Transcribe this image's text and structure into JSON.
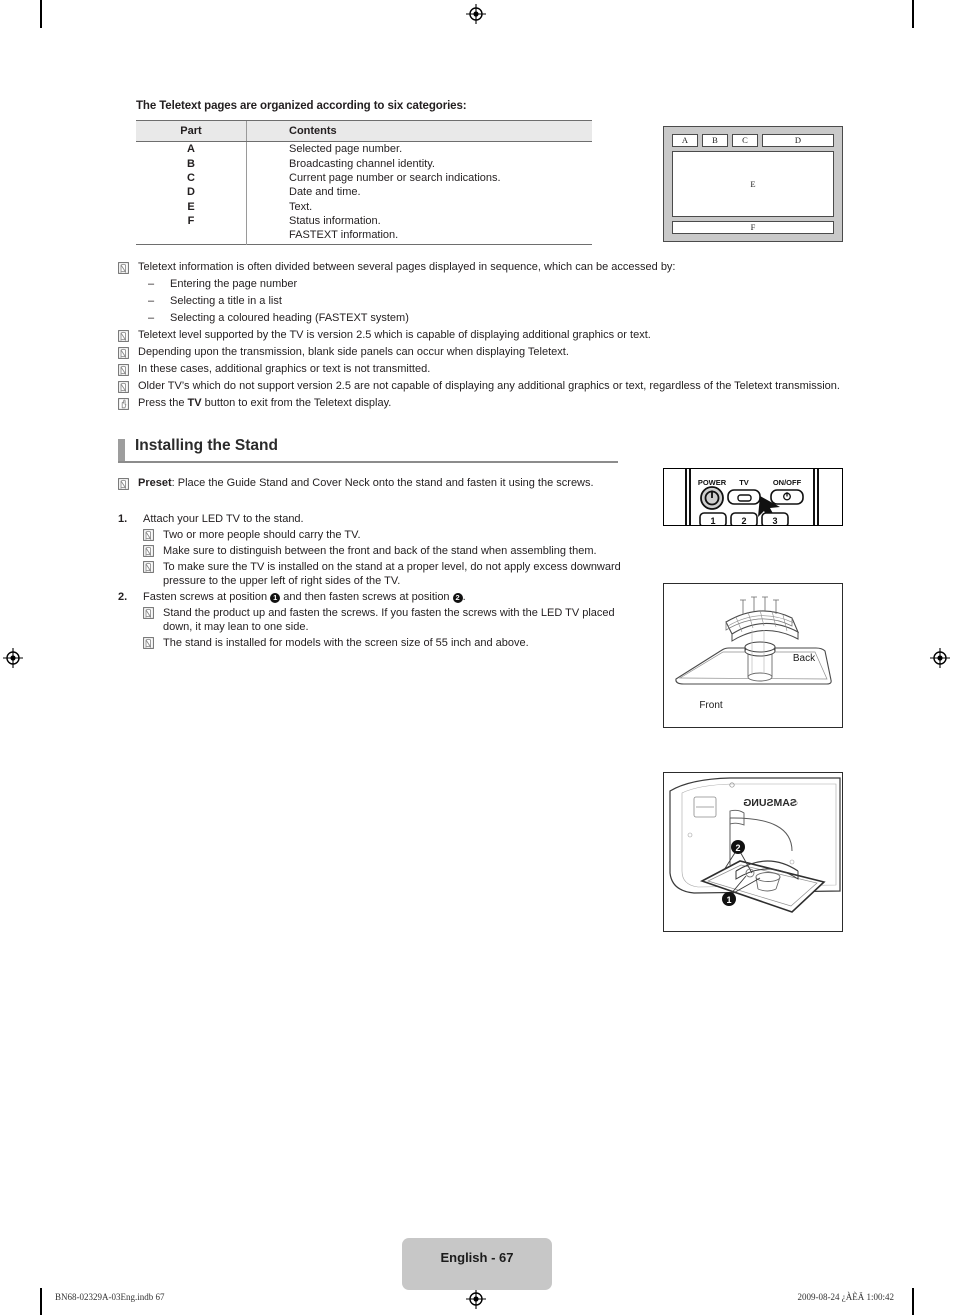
{
  "document": {
    "intro_line": "The Teletext pages are organized according to six categories:",
    "section_heading": "Installing the Stand",
    "page_tag": "English - 67",
    "footer_left": "BN68-02329A-03Eng.indb   67",
    "footer_right": "2009-08-24   ¿ÀÈÄ 1:00:42"
  },
  "table": {
    "headers": [
      "Part",
      "Contents"
    ],
    "rows": [
      {
        "part": "A",
        "contents": "Selected page number."
      },
      {
        "part": "B",
        "contents": "Broadcasting channel identity."
      },
      {
        "part": "C",
        "contents": "Current page number or search indications."
      },
      {
        "part": "D",
        "contents": "Date and time."
      },
      {
        "part": "E",
        "contents": "Text."
      },
      {
        "part": "F",
        "contents": "Status information."
      },
      {
        "part": "",
        "contents": "FASTEXT information."
      }
    ]
  },
  "teletext_figure": {
    "labels": {
      "a": "A",
      "b": "B",
      "c": "C",
      "d": "D",
      "e": "E",
      "f": "F"
    }
  },
  "notes": [
    {
      "icon": "note-icon",
      "text": "Teletext information is often divided between several pages displayed in sequence, which can be accessed by:"
    },
    {
      "icon": "note-icon",
      "text": "Teletext level supported by the TV is version 2.5 which is capable of displaying additional graphics or text."
    },
    {
      "icon": "note-icon",
      "text": "Depending upon the transmission, blank side panels can occur when displaying Teletext."
    },
    {
      "icon": "note-icon",
      "text": "In these cases, additional graphics or text is not transmitted."
    },
    {
      "icon": "note-icon",
      "text": "Older TV’s which do not support version 2.5 are not capable of displaying any additional graphics or text, regardless of the Teletext transmission."
    },
    {
      "icon": "hand-icon",
      "text_prefix": "Press the ",
      "text_bold": "TV",
      "text_suffix": " button to exit from the Teletext display."
    }
  ],
  "dash_items": [
    {
      "dash": "–",
      "text": "Entering the page number"
    },
    {
      "dash": "–",
      "text": "Selecting a title in a list"
    },
    {
      "dash": "–",
      "text": "Selecting a coloured heading (FASTEXT system)"
    }
  ],
  "preset_note": {
    "icon": "note-icon",
    "bold": "Preset",
    "text": ": Place the Guide Stand and Cover Neck onto the stand and fasten it using the screws."
  },
  "remote_figure": {
    "power_label": "POWER",
    "tv_label": "TV",
    "onoff_label": "ON/OFF",
    "keys": [
      "1",
      "2",
      "3"
    ]
  },
  "stand_figure": {
    "back_label": "Back",
    "front_label": "Front"
  },
  "tvback_figure": {
    "brand": "SAMSUNG",
    "marker_one": "1",
    "marker_two": "2"
  },
  "steps": [
    {
      "number": "1.",
      "text": "Attach your LED TV to the stand.",
      "subnotes": [
        {
          "text": "Two or more people should carry the TV."
        },
        {
          "text": "Make sure to distinguish between the front and back of the stand when assembling them."
        },
        {
          "text": "To make sure the TV is installed on the stand at a proper level, do not apply excess downward pressure to the upper left of right sides of the TV."
        }
      ]
    },
    {
      "number": "2.",
      "text_part1": "Fasten screws at position ",
      "marker1": "1",
      "text_part2": " and then fasten screws at position ",
      "marker2": "2",
      "text_part3": ".",
      "subnotes": [
        {
          "text": "Stand the product up and fasten the screws. If you fasten the screws with the LED TV placed down, it may lean to one side."
        },
        {
          "text": "The stand is installed for models with the screen size of 55 inch and above."
        }
      ]
    }
  ],
  "colors": {
    "table_header_bg": "#e9e9e9",
    "section_bar": "#9d9d9d",
    "section_rule": "#8c8c8c",
    "page_tag_bg": "#c7c7c7",
    "figure_bg": "#c9c9c9"
  }
}
